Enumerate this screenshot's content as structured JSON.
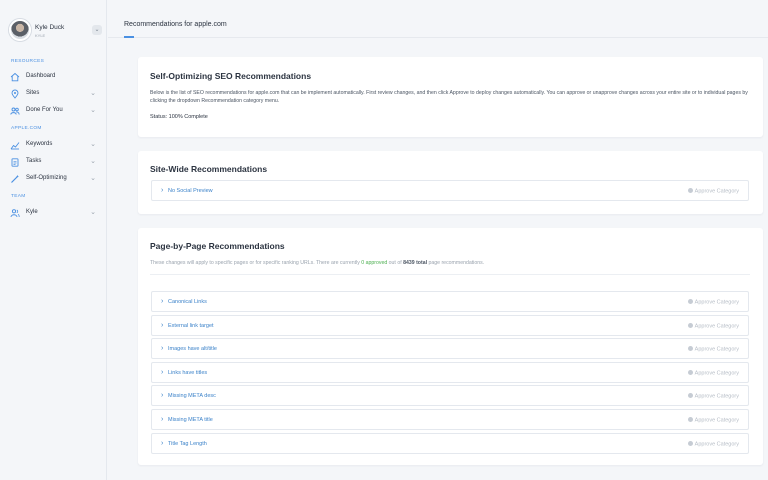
{
  "user": {
    "name": "Kyle Duck",
    "sub": "KYLE",
    "toggle": "⌄"
  },
  "sidebar": {
    "sections": [
      {
        "label": "RESOURCES"
      },
      {
        "label": "APPLE.COM"
      },
      {
        "label": "TEAM"
      }
    ],
    "items": [
      {
        "label": "Dashboard",
        "icon": "home-icon",
        "chevron": ""
      },
      {
        "label": "Sites",
        "icon": "location-pin-icon",
        "chevron": "⌄"
      },
      {
        "label": "Done For You",
        "icon": "users-icon",
        "chevron": "⌄"
      },
      {
        "label": "Keywords",
        "icon": "chart-icon",
        "chevron": "⌄"
      },
      {
        "label": "Tasks",
        "icon": "clipboard-icon",
        "chevron": "⌄"
      },
      {
        "label": "Self-Optimizing",
        "icon": "wand-icon",
        "chevron": "⌄"
      },
      {
        "label": "Kyle",
        "icon": "team-icon",
        "chevron": "⌄"
      }
    ]
  },
  "header": {
    "title": "Recommendations for apple.com"
  },
  "intro": {
    "title": "Self-Optimizing SEO Recommendations",
    "description": "Below is the list of SEO recommendations for apple.com that can be implement automatically. First review changes, and then click Approve to deploy changes automatically. You can approve or unapprove changes across your entire site or to individual pages by clicking the dropdown Recommendation category menu.",
    "status": "Status: 100% Complete"
  },
  "sitewide": {
    "title": "Site-Wide Recommendations",
    "rows": [
      {
        "label": "No Social Preview",
        "action": "Approve Category"
      }
    ]
  },
  "pagebypage": {
    "title": "Page-by-Page Recommendations",
    "desc_prefix": "These changes will apply to specific pages or for specific ranking URLs. There are currently ",
    "approved": "0 approved",
    "desc_middle": " out of ",
    "total": "8439 total",
    "desc_suffix": " page recommendations.",
    "rows": [
      {
        "label": "Canonical Links",
        "action": "Approve Category"
      },
      {
        "label": "External link target",
        "action": "Approve Category"
      },
      {
        "label": "Images have alt/title",
        "action": "Approve Category"
      },
      {
        "label": "Links have titles",
        "action": "Approve Category"
      },
      {
        "label": "Missing META desc",
        "action": "Approve Category"
      },
      {
        "label": "Missing META title",
        "action": "Approve Category"
      },
      {
        "label": "Title Tag Length",
        "action": "Approve Category"
      }
    ]
  },
  "colors": {
    "accent": "#4a90e2",
    "link": "#3b82c9",
    "approved": "#4caf50",
    "muted": "#b6bdc6"
  }
}
